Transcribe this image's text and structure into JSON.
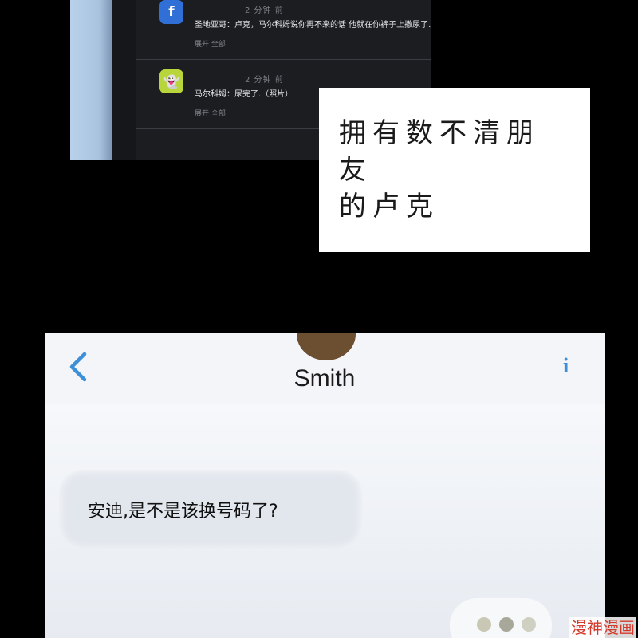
{
  "notifications": [
    {
      "app_icon": "facebook-icon",
      "icon_glyph": "f",
      "time": "2 分钟 前",
      "message": "圣地亚哥：卢克，马尔科姆说你再不来的话 他就在你裤子上撒尿了.",
      "expand_label": "展开 全部"
    },
    {
      "app_icon": "snapchat-icon",
      "icon_glyph": "👻",
      "time": "2 分钟 前",
      "message": "马尔科姆：尿完了.（照片）",
      "expand_label": "展开 全部"
    }
  ],
  "caption": {
    "line1": "拥有数不清朋友",
    "line2": "的卢克"
  },
  "messages_screen": {
    "contact_name": "Smith",
    "info_glyph": "i",
    "incoming_message": "安迪,是不是该换号码了?",
    "typing_indicator": "typing-dots"
  },
  "watermark": "漫神漫画",
  "colors": {
    "accent_blue": "#3d8fd8",
    "facebook_blue": "#2f6fd6",
    "snapchat_yellow": "#b8d63c",
    "watermark_red": "#d33a2c"
  }
}
